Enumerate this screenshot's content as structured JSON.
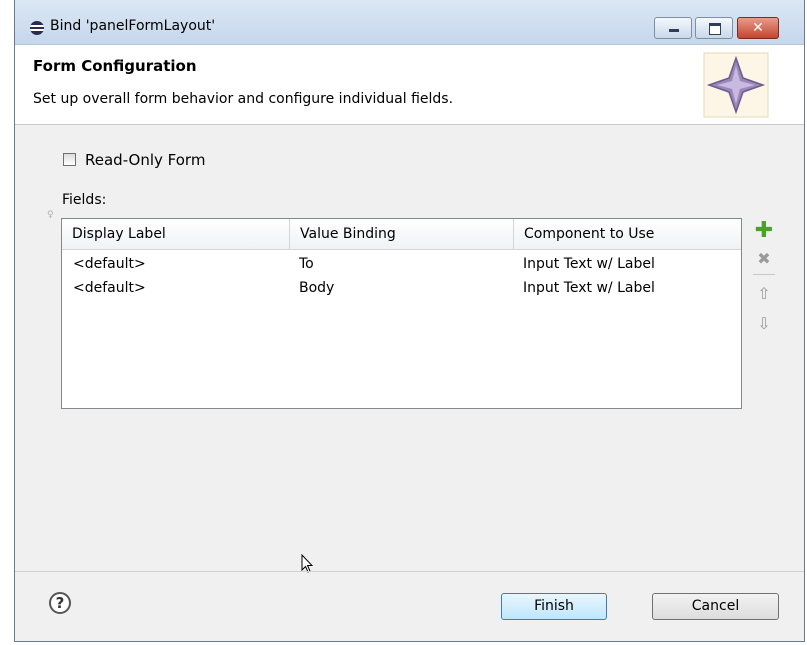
{
  "window": {
    "title": "Bind 'panelFormLayout'",
    "close_glyph": "✕"
  },
  "header": {
    "title": "Form Configuration",
    "description": "Set up overall form behavior and configure individual fields."
  },
  "form": {
    "readonly_label": "Read-Only Form",
    "readonly_checked": false,
    "fields_label": "Fields:"
  },
  "table": {
    "columns": [
      "Display Label",
      "Value Binding",
      "Component to Use"
    ],
    "rows": [
      [
        "<default>",
        "To",
        "Input Text w/ Label"
      ],
      [
        "<default>",
        "Body",
        "Input Text w/ Label"
      ]
    ]
  },
  "side_buttons": {
    "add": "✚",
    "remove": "✖",
    "up": "⇧",
    "down": "⇩"
  },
  "footer": {
    "help": "?",
    "finish_label": "Finish",
    "cancel_label": "Cancel"
  },
  "colors": {
    "accent": "#3c7fb1",
    "add_green": "#4aa12a"
  }
}
